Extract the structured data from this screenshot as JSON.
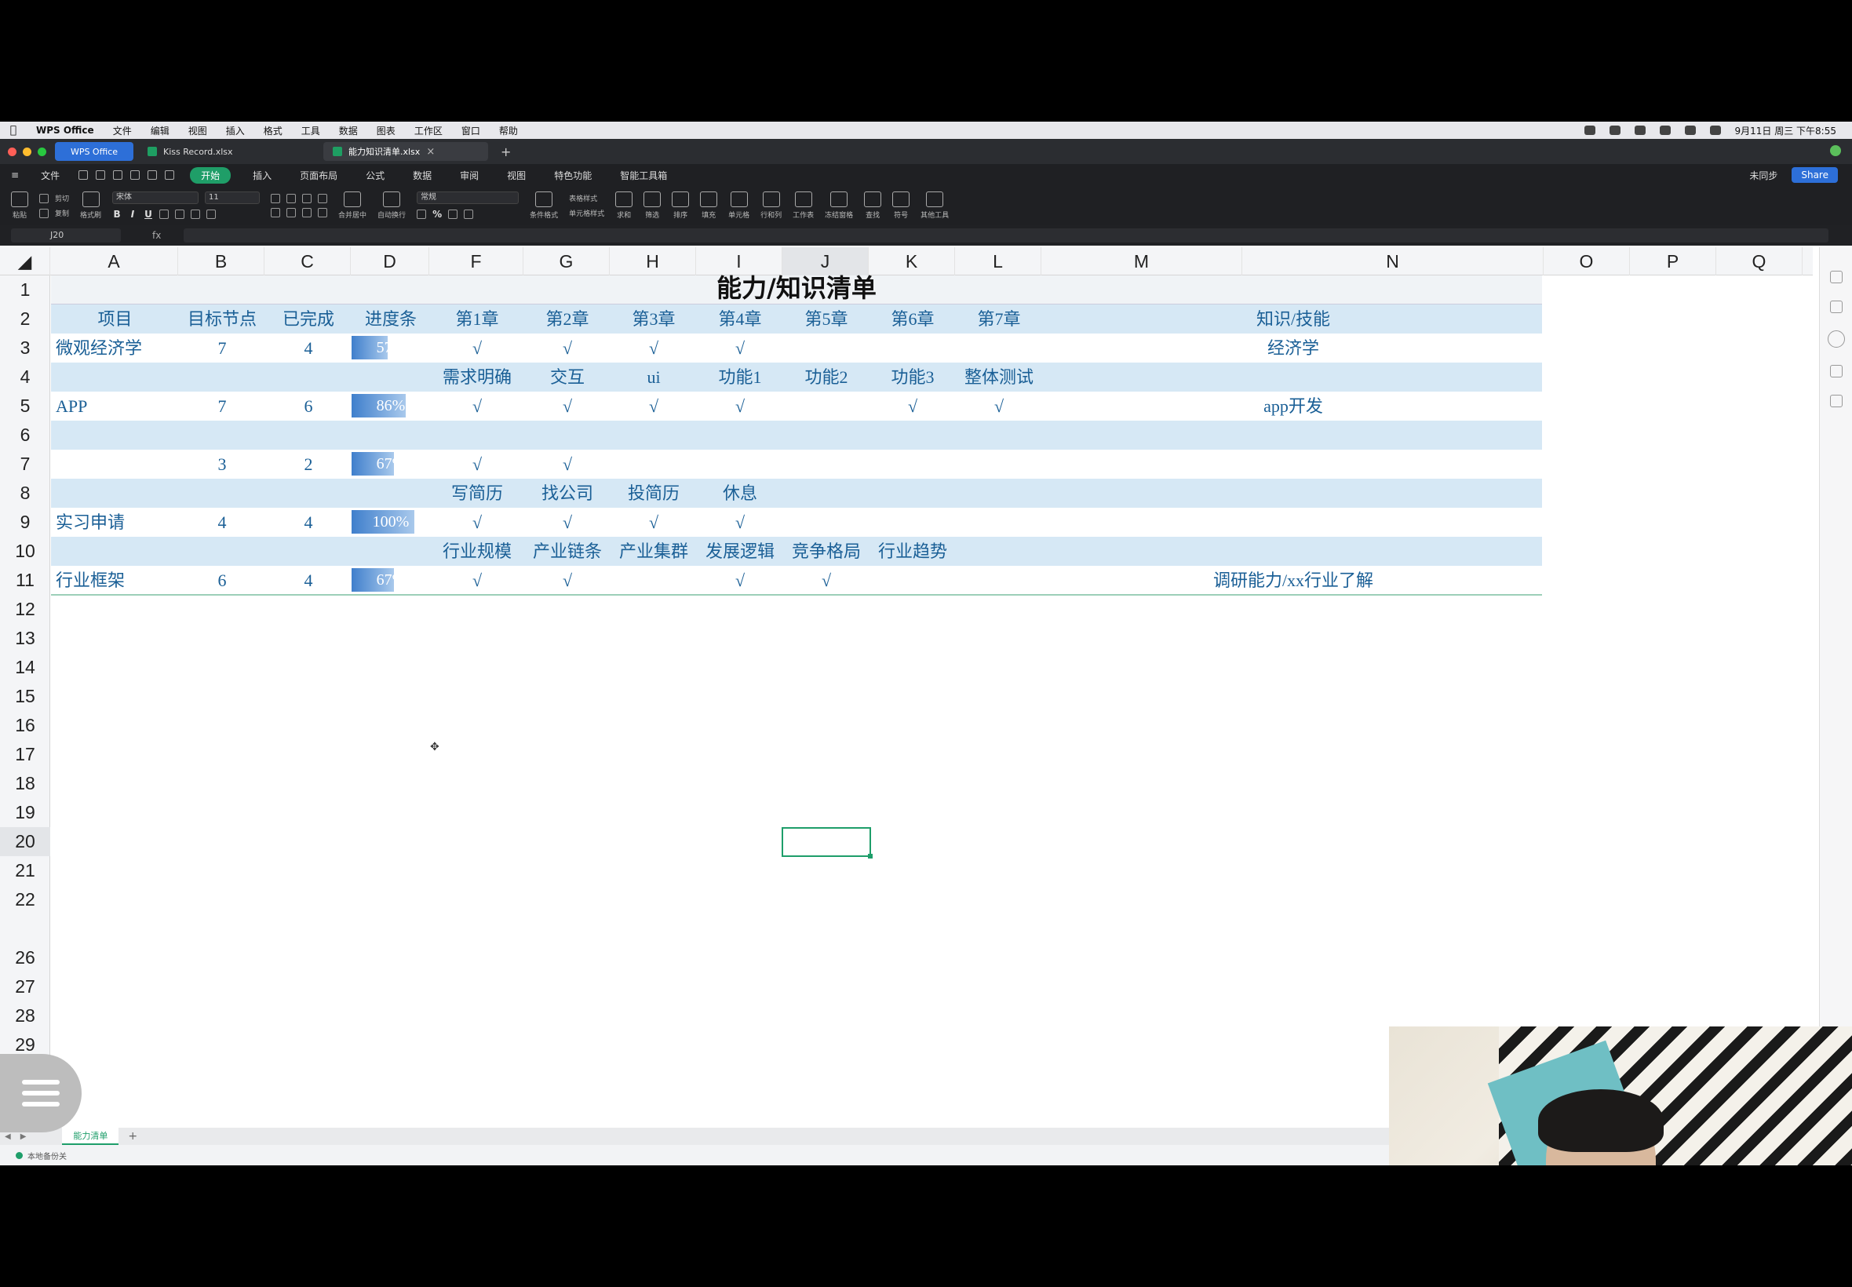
{
  "menubar": {
    "app": "WPS Office",
    "items": [
      "文件",
      "编辑",
      "视图",
      "插入",
      "格式",
      "工具",
      "数据",
      "图表",
      "工作区",
      "窗口",
      "帮助"
    ],
    "clock": "9月11日 周三 下午8:55"
  },
  "tabs": {
    "home": "WPS Office",
    "file1": "Kiss Record.xlsx",
    "file2": "能力知识清单.xlsx"
  },
  "ribbon": {
    "file": "文件",
    "items": [
      "开始",
      "插入",
      "页面布局",
      "公式",
      "数据",
      "审阅",
      "视图",
      "特色功能",
      "智能工具箱"
    ],
    "sync": "未同步",
    "share": "Share"
  },
  "toolbar": {
    "paste": "粘贴",
    "cut": "剪切",
    "copy": "复制",
    "format_painter": "格式刷",
    "font": "宋体",
    "size": "11",
    "number_format": "常规",
    "merge": "合并居中",
    "wrap": "自动换行",
    "cond_format": "条件格式",
    "table_style": "表格样式",
    "cell_style": "单元格样式",
    "sum": "求和",
    "filter": "筛选",
    "sort": "排序",
    "fill": "填充",
    "cells": "单元格",
    "rowcol": "行和列",
    "worksheet": "工作表",
    "freeze": "冻结窗格",
    "find": "查找",
    "symbol": "符号",
    "tools": "其他工具"
  },
  "formula": {
    "namebox": "J20",
    "fx": "fx"
  },
  "columns": [
    "A",
    "B",
    "C",
    "D",
    "F",
    "G",
    "H",
    "I",
    "J",
    "K",
    "L",
    "M",
    "N",
    "O",
    "P",
    "Q"
  ],
  "rows": [
    "1",
    "2",
    "3",
    "4",
    "5",
    "6",
    "7",
    "8",
    "9",
    "10",
    "11",
    "12",
    "13",
    "14",
    "15",
    "16",
    "17",
    "18",
    "19",
    "20",
    "21",
    "22",
    "26",
    "27",
    "28",
    "29"
  ],
  "sheet": {
    "title": "能力/知识清单",
    "header": {
      "a": "项目",
      "b": "目标节点",
      "c": "已完成",
      "d": "进度条",
      "f": "第1章",
      "g": "第2章",
      "h": "第3章",
      "i": "第4章",
      "j": "第5章",
      "k": "第6章",
      "l": "第7章",
      "n": "知识/技能"
    },
    "r3": {
      "a": "微观经济学",
      "b": "7",
      "c": "4",
      "d": "57%",
      "f": "√",
      "g": "√",
      "h": "√",
      "i": "√",
      "n": "经济学"
    },
    "r4": {
      "f": "需求明确",
      "g": "交互",
      "h": "ui",
      "i": "功能1",
      "j": "功能2",
      "k": "功能3",
      "l": "整体测试"
    },
    "r5": {
      "a": "APP",
      "b": "7",
      "c": "6",
      "d": "86%",
      "f": "√",
      "g": "√",
      "h": "√",
      "i": "√",
      "k": "√",
      "l": "√",
      "n": "app开发"
    },
    "r7": {
      "b": "3",
      "c": "2",
      "d": "67%",
      "f": "√",
      "g": "√"
    },
    "r8": {
      "f": "写简历",
      "g": "找公司",
      "h": "投简历",
      "i": "休息"
    },
    "r9": {
      "a": "实习申请",
      "b": "4",
      "c": "4",
      "d": "100%",
      "f": "√",
      "g": "√",
      "h": "√",
      "i": "√"
    },
    "r10": {
      "f": "行业规模",
      "g": "产业链条",
      "h": "产业集群",
      "i": "发展逻辑",
      "j": "竞争格局",
      "k": "行业趋势"
    },
    "r11": {
      "a": "行业框架",
      "b": "6",
      "c": "4",
      "d": "67%",
      "f": "√",
      "g": "√",
      "i": "√",
      "j": "√",
      "n": "调研能力/xx行业了解"
    },
    "progress": {
      "r3": 0.57,
      "r5": 0.86,
      "r7": 0.67,
      "r9": 1.0,
      "r11": 0.67
    }
  },
  "sheettab": "能力清单",
  "status": "本地备份关",
  "colors": {
    "band": "#d6e8f5",
    "text": "#1a5f96",
    "accent": "#1e9e6a",
    "bar": "#3f7fcc"
  }
}
